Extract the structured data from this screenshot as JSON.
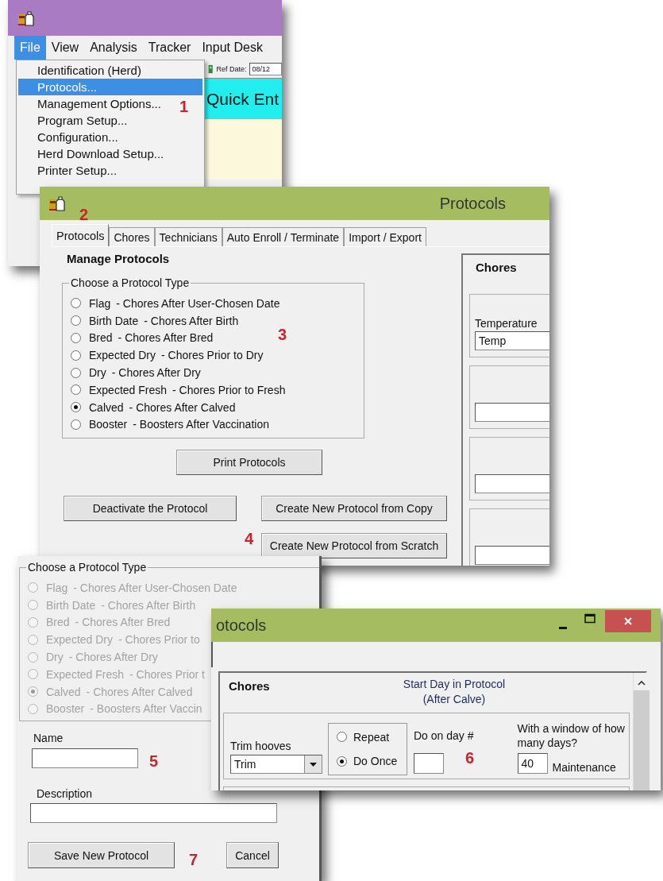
{
  "main_window": {
    "menu": [
      {
        "label": "File",
        "selected": true
      },
      {
        "label": "View",
        "selected": false
      },
      {
        "label": "Analysis",
        "selected": false
      },
      {
        "label": "Tracker",
        "selected": false
      },
      {
        "label": "Input Desk",
        "selected": false
      }
    ],
    "file_menu": [
      {
        "label": "Identification (Herd)",
        "selected": false
      },
      {
        "label": "Protocols...",
        "selected": true
      },
      {
        "label": "Management Options...",
        "selected": false
      },
      {
        "label": "Program Setup...",
        "selected": false
      },
      {
        "label": "Configuration...",
        "selected": false
      },
      {
        "label": "Herd Download Setup...",
        "selected": false
      },
      {
        "label": "Printer Setup...",
        "selected": false
      }
    ],
    "toolbar": {
      "ref_date_label": "Ref Date:",
      "ref_date": "08/12"
    },
    "banner": "Quick Ent",
    "callout": "1"
  },
  "protocols_window": {
    "title": "Protocols",
    "tabs": [
      {
        "label": "Protocols",
        "selected": true
      },
      {
        "label": "Chores",
        "selected": false
      },
      {
        "label": "Technicians",
        "selected": false
      },
      {
        "label": "Auto Enroll / Terminate",
        "selected": false
      },
      {
        "label": "Import / Export",
        "selected": false
      }
    ],
    "heading": "Manage Protocols",
    "protocol_type": {
      "legend": "Choose a Protocol Type",
      "disabled": false,
      "options": [
        {
          "name": "Flag",
          "description": "- Chores After User-Chosen Date",
          "selected": false
        },
        {
          "name": "Birth Date",
          "description": "- Chores After Birth",
          "selected": false
        },
        {
          "name": "Bred",
          "description": "- Chores After Bred",
          "selected": false
        },
        {
          "name": "Expected Dry",
          "description": "- Chores Prior to Dry",
          "selected": false
        },
        {
          "name": "Dry",
          "description": "- Chores After Dry",
          "selected": false
        },
        {
          "name": "Expected Fresh",
          "description": "- Chores Prior to Fresh",
          "selected": false
        },
        {
          "name": "Calved",
          "description": "- Chores After Calved",
          "selected": true
        },
        {
          "name": "Booster",
          "description": "- Boosters After Vaccination",
          "selected": false
        }
      ]
    },
    "buttons": [
      "Print Protocols",
      "Deactivate the Protocol",
      "Create New Protocol from Copy",
      "Create New Protocol from Scratch"
    ],
    "chores_panel": {
      "title": "Chores",
      "fields": [
        {
          "kind": "labeled",
          "label": "Temperature",
          "value": "Temp"
        },
        {
          "kind": "empty"
        },
        {
          "kind": "empty"
        },
        {
          "kind": "empty"
        }
      ]
    },
    "callouts": [
      "2",
      "3",
      "4"
    ]
  },
  "new_protocol_panel": {
    "protocol_type": {
      "legend": "Choose a Protocol Type",
      "disabled": true,
      "options": [
        {
          "name": "Flag",
          "description": "- Chores After User-Chosen Date",
          "selected": false
        },
        {
          "name": "Birth Date",
          "description": "- Chores After Birth",
          "selected": false
        },
        {
          "name": "Bred",
          "description": "- Chores After Bred",
          "selected": false
        },
        {
          "name": "Expected Dry",
          "description": "- Chores Prior to",
          "selected": false
        },
        {
          "name": "Dry",
          "description": "- Chores After Dry",
          "selected": false
        },
        {
          "name": "Expected Fresh",
          "description": "- Chores Prior t",
          "selected": false
        },
        {
          "name": "Calved",
          "description": "- Chores After Calved",
          "selected": true
        },
        {
          "name": "Booster",
          "description": "- Boosters After Vaccin",
          "selected": false
        }
      ]
    },
    "name_label": "Name",
    "description_label": "Description",
    "buttons": [
      "Save New Protocol",
      "Cancel"
    ],
    "callouts": [
      "5",
      "7"
    ]
  },
  "chores_window": {
    "title": "otocols",
    "heading": "Chores",
    "start_day": "Start Day in Protocol",
    "start_day_note": "(After Calve)",
    "chore": {
      "label": "Trim hooves",
      "value": "Trim",
      "frequency": [
        {
          "label": "Repeat",
          "selected": false
        },
        {
          "label": "Do Once",
          "selected": true
        }
      ],
      "day_label": "Do on day #",
      "window_label": "With a window of how many days?",
      "window_value": "40",
      "category": "Maintenance"
    },
    "callout": "6"
  }
}
